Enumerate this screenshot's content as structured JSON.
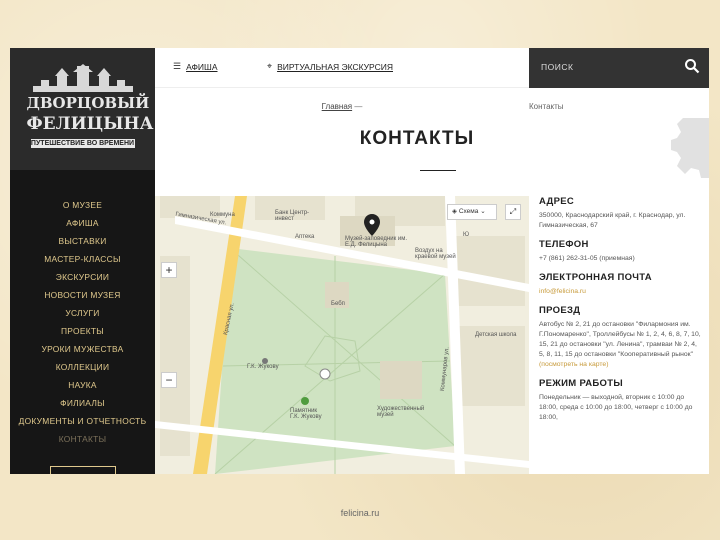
{
  "logo": {
    "line1": "ДВОРЦОВЫЙ",
    "line2": "ФЕЛИЦЫНА",
    "tagline": "ПУТЕШЕСТВИЕ ВО ВРЕМЕНИ"
  },
  "sidebar": {
    "items": [
      {
        "label": "О музее"
      },
      {
        "label": "Афиша"
      },
      {
        "label": "Выставки"
      },
      {
        "label": "Мастер-классы"
      },
      {
        "label": "Экскурсии"
      },
      {
        "label": "Новости музея"
      },
      {
        "label": "Услуги"
      },
      {
        "label": "Проекты"
      },
      {
        "label": "Уроки мужества"
      },
      {
        "label": "Коллекции"
      },
      {
        "label": "Наука"
      },
      {
        "label": "Филиалы"
      },
      {
        "label": "Документы и отчетность"
      },
      {
        "label": "Контакты"
      }
    ]
  },
  "topbar": {
    "afisha": "АФИША",
    "tour": "ВИРТУАЛЬНАЯ ЭКСКУРСИЯ",
    "search": "ПОИСК"
  },
  "breadcrumb": {
    "home": "Главная",
    "sep": "—",
    "current": "Контакты"
  },
  "page": {
    "title": "КОНТАКТЫ"
  },
  "map": {
    "layers": "Схема",
    "zoom_in": "+",
    "zoom_out": "−",
    "fullscreen": "⤢",
    "labels": {
      "street1": "Гимназическая ул.",
      "street2": "Красная ул.",
      "street3": "Коммунаров ул.",
      "park": "Бебп",
      "museum": "Музей-заповедник им. Е.Д. Фелицына",
      "zhukov": "Г.К. Жукову",
      "monument": "Памятник Г.К. Жукову",
      "art": "Художественный музей",
      "rear": "Воздух на краевой музей",
      "shop": "Коммуна",
      "bank": "Банк Центр-инвест",
      "pharmacy": "Аптека",
      "sq": "Ю",
      "school": "Детская школа"
    }
  },
  "contacts": {
    "address_h": "АДРЕС",
    "address": "350000, Краснодарский край, г. Краснодар, ул. Гимназическая, 67",
    "phone_h": "ТЕЛЕФОН",
    "phone": "+7 (861) 262-31-05 (приемная)",
    "email_h": "ЭЛЕКТРОННАЯ ПОЧТА",
    "email": "info@felicina.ru",
    "route_h": "ПРОЕЗД",
    "route": "Автобус № 2, 21 до остановки \"Филармония им. Г.Пономаренко\", Троллейбусы № 1, 2, 4, 6, 8, 7, 10, 15, 21 до остановки \"ул. Ленина\", трамваи № 2, 4, 5, 8, 11, 15 до остановки \"Кооперативный рынок\"",
    "route_link": "(посмотреть на карте)",
    "hours_h": "РЕЖИМ РАБОТЫ",
    "hours": "Понедельник — выходной, вторник с 10:00 до 18:00, среда с 10:00 до 18:00, четверг с 10:00 до 18:00,"
  },
  "footer": "felicina.ru"
}
